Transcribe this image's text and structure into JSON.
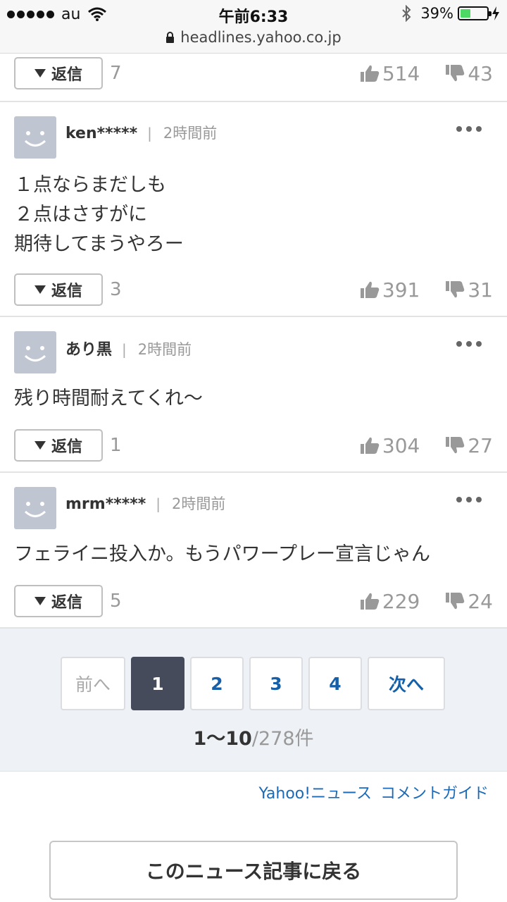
{
  "status_bar": {
    "carrier": "au",
    "time": "午前6:33",
    "battery_percent": "39%",
    "battery_level": 0.39
  },
  "browser": {
    "url": "headlines.yahoo.co.jp"
  },
  "reply_label": "返信",
  "comments": [
    {
      "partial": true,
      "replies": "7",
      "likes": "514",
      "dislikes": "43"
    },
    {
      "user": "ken*****",
      "time": "2時間前",
      "body": "１点ならまだしも\n２点はさすがに\n期待してまうやろー",
      "replies": "3",
      "likes": "391",
      "dislikes": "31"
    },
    {
      "user": "あり黒",
      "time": "2時間前",
      "body": "残り時間耐えてくれ〜",
      "replies": "1",
      "likes": "304",
      "dislikes": "27"
    },
    {
      "user": "mrm*****",
      "time": "2時間前",
      "body": "フェライニ投入か。もうパワープレー宣言じゃん",
      "replies": "5",
      "likes": "229",
      "dislikes": "24"
    }
  ],
  "pagination": {
    "prev": "前へ",
    "pages": [
      "1",
      "2",
      "3",
      "4"
    ],
    "current": "1",
    "next": "次へ",
    "range": "1〜10",
    "total": "/278件"
  },
  "footer": {
    "guide_links": [
      "Yahoo!ニュース",
      "コメントガイド"
    ],
    "back_button": "このニュース記事に戻る"
  },
  "colors": {
    "link": "#1a6ab8",
    "current_page": "#454b5a",
    "battery": "#4cd964"
  }
}
